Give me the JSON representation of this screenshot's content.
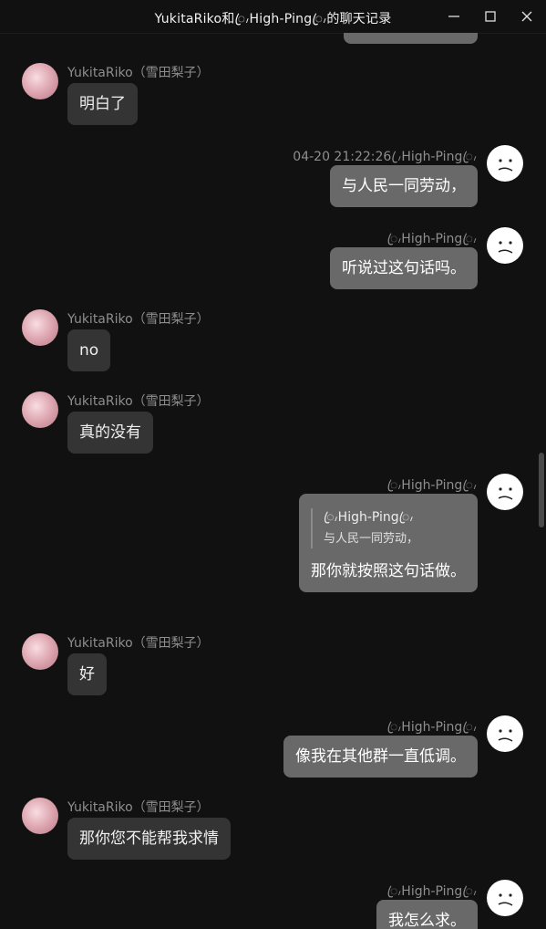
{
  "window": {
    "title": "YukitaRiko和ꦿ៸High-Pingꦿ៸的聊天记录",
    "controls": [
      "minimize-icon",
      "maximize-icon",
      "close-icon"
    ]
  },
  "contacts": {
    "other_name": "YukitaRiko（雪田梨子）",
    "self_name": "ꦿ៸High-Pingꦿ៸"
  },
  "messages": [
    {
      "from": "other",
      "text": "明白了"
    },
    {
      "from": "self",
      "time": "04-20 21:22:26",
      "text": "与人民一同劳动，"
    },
    {
      "from": "self",
      "text": "听说过这句话吗。"
    },
    {
      "from": "other",
      "text": "no"
    },
    {
      "from": "other",
      "text": "真的没有"
    },
    {
      "from": "self",
      "quote": {
        "name": "ꦿ៸High-Pingꦿ៸",
        "text": "与人民一同劳动，"
      },
      "text": "那你就按照这句话做。"
    },
    {
      "from": "other",
      "text": "好"
    },
    {
      "from": "self",
      "text": "像我在其他群一直低调。"
    },
    {
      "from": "other",
      "text": "那你您不能帮我求情"
    },
    {
      "from": "self",
      "text": "我怎么求。"
    }
  ],
  "colors": {
    "background": "#111111",
    "bubble_other": "#343434",
    "bubble_self": "#696969",
    "name_text": "#8e8e8e"
  }
}
